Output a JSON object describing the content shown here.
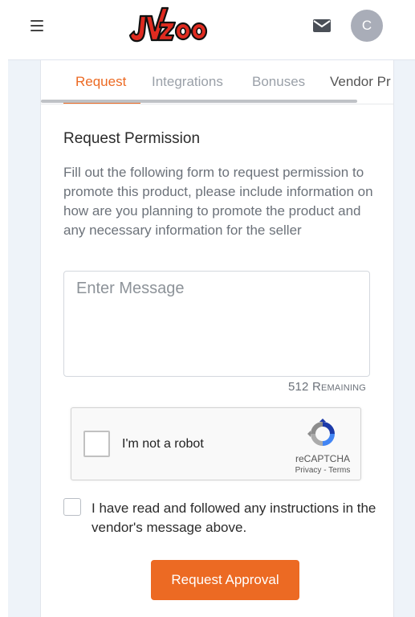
{
  "header": {
    "logo_text": "JVZoo",
    "avatar_initial": "C"
  },
  "tabs": [
    {
      "label": "Request",
      "active": true
    },
    {
      "label": "Integrations",
      "active": false
    },
    {
      "label": "Bonuses",
      "active": false
    },
    {
      "label": "Vendor Pr",
      "active": false
    }
  ],
  "form": {
    "title": "Request Permission",
    "description": "Fill out the following form to request permission to promote this product, please include information on how are you planning to promote the product and any necessary information for the seller",
    "message_placeholder": "Enter Message",
    "remaining_count": "512",
    "remaining_label": "Remaining",
    "agreement_text": "I have read and followed any instructions in the vendor's message above.",
    "submit_label": "Request Approval"
  },
  "captcha": {
    "label": "I'm not a robot",
    "brand": "reCAPTCHA",
    "privacy": "Privacy",
    "separator": " - ",
    "terms": "Terms"
  },
  "colors": {
    "accent": "#ec6a23",
    "logo_red": "#e02b20",
    "avatar": "#a9adb8"
  }
}
